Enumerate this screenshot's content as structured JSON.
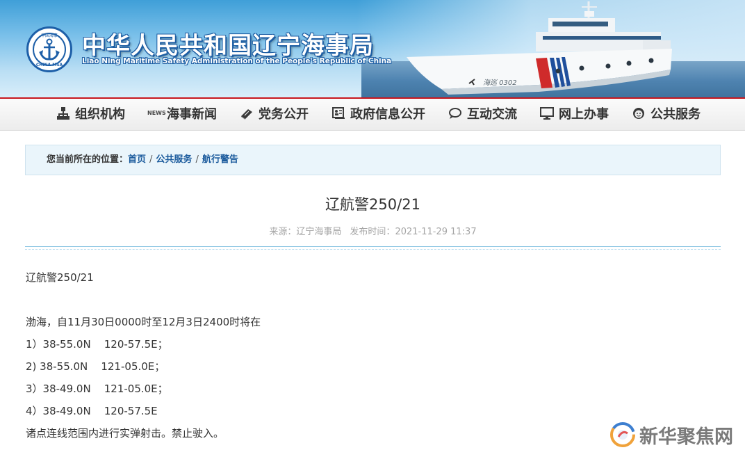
{
  "header": {
    "site_title": "中华人民共和国辽宁海事局",
    "site_subtitle": "Liao Ning Maritime Safety Administration of the People's Republic of China",
    "emblem_text_cn": "中国海事",
    "emblem_text_en": "CHINA MSA",
    "ship_hull_text": "海巡 0302"
  },
  "nav": {
    "items": [
      {
        "label": "组织机构",
        "icon": "org-chart-icon"
      },
      {
        "label": "海事新闻",
        "icon": "news-icon",
        "icon_text": "NEWS"
      },
      {
        "label": "党务公开",
        "icon": "book-icon"
      },
      {
        "label": "政府信息公开",
        "icon": "info-card-icon"
      },
      {
        "label": "互动交流",
        "icon": "chat-icon"
      },
      {
        "label": "网上办事",
        "icon": "monitor-icon"
      },
      {
        "label": "公共服务",
        "icon": "service-face-icon"
      }
    ]
  },
  "breadcrumb": {
    "label": "您当前所在的位置：",
    "items": [
      "首页",
      "公共服务",
      "航行警告"
    ],
    "separator": "/"
  },
  "article": {
    "title": "辽航警250/21",
    "source_label": "来源：",
    "source": "辽宁海事局",
    "time_label": "发布时间：",
    "time": "2021-11-29 11:37",
    "body": {
      "code": "辽航警250/21",
      "intro": "渤海，自11月30日0000时至12月3日2400时将在",
      "points": [
        "1）38-55.0N    120-57.5E；",
        "2) 38-55.0N    121-05.0E；",
        "3）38-49.0N    121-05.0E；",
        "4）38-49.0N    120-57.5E"
      ],
      "conclusion": "诸点连线范围内进行实弹射击。禁止驶入。"
    }
  },
  "watermark": {
    "text": "新华聚焦网"
  },
  "colors": {
    "nav_top_border": "#c8161d",
    "link": "#1a5a9c",
    "meta_text": "#a5a5a5",
    "divider": "#8ec7e4",
    "breadcrumb_bg": "#eaf5fb"
  }
}
